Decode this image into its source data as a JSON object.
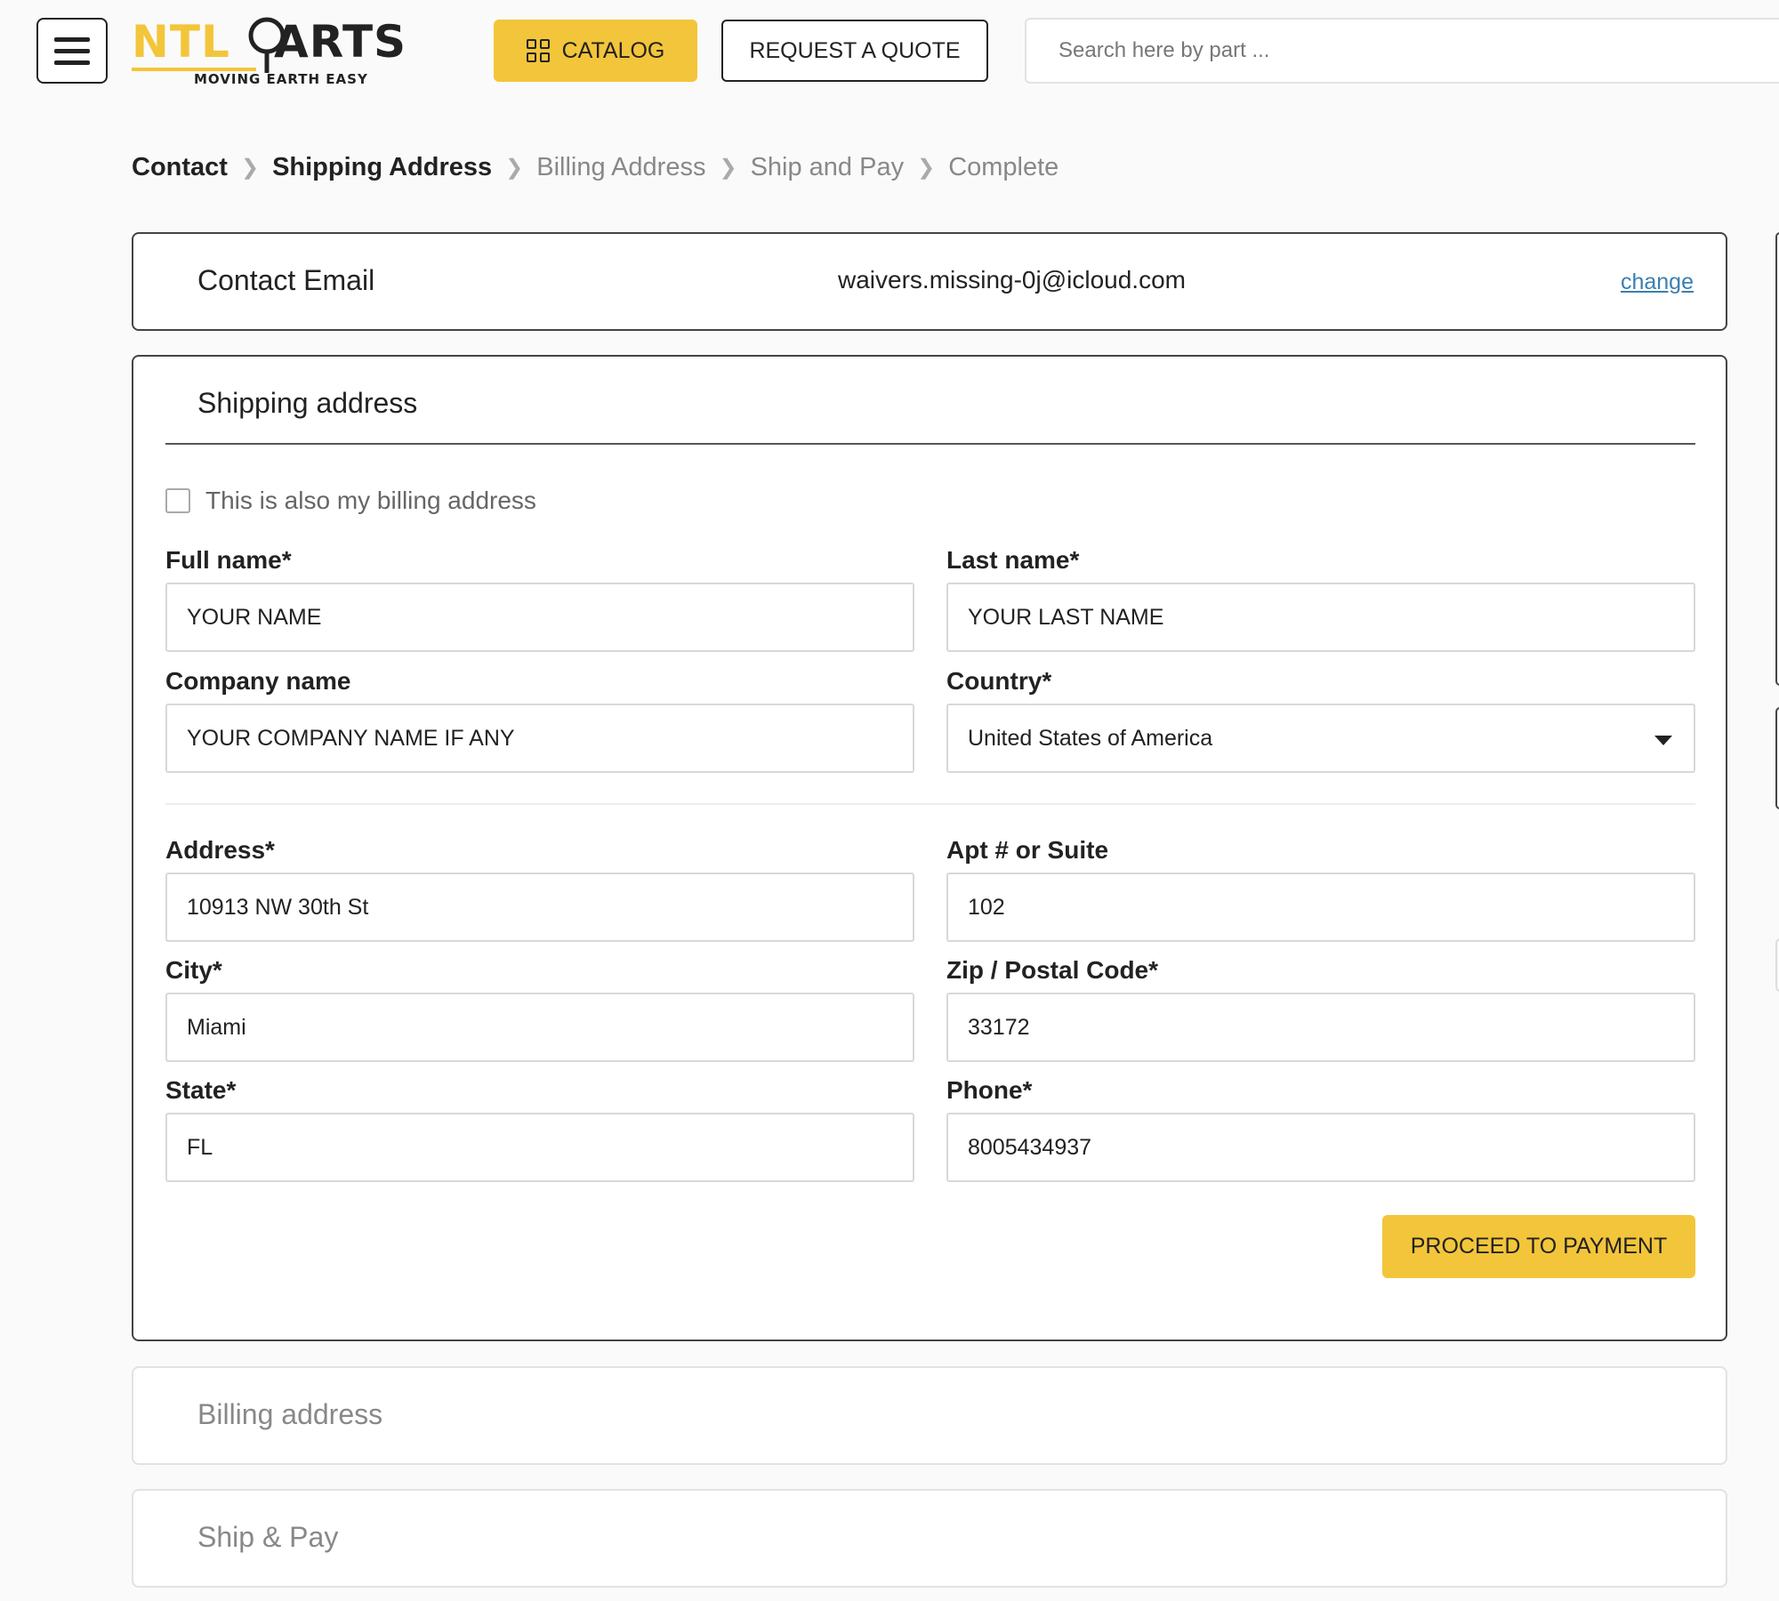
{
  "header": {
    "logo": {
      "brand_left": "NTL",
      "brand_right": "ARTS",
      "tagline": "MOVING EARTH EASY"
    },
    "catalog_label": "CATALOG",
    "quote_label": "REQUEST A QUOTE",
    "search_placeholder": "Search here by part ..."
  },
  "breadcrumb": [
    {
      "label": "Contact"
    },
    {
      "label": "Shipping Address"
    },
    {
      "label": "Billing Address"
    },
    {
      "label": "Ship and Pay"
    },
    {
      "label": "Complete"
    }
  ],
  "contact": {
    "label": "Contact Email",
    "email": "waivers.missing-0j@icloud.com",
    "change_label": "change"
  },
  "shipping": {
    "title": "Shipping address",
    "billing_checkbox_label": "This is also my billing address",
    "fields": {
      "full_name": {
        "label": "Full name*",
        "value": "YOUR NAME"
      },
      "last_name": {
        "label": "Last name*",
        "value": "YOUR LAST NAME"
      },
      "company": {
        "label": "Company name",
        "value": "YOUR COMPANY NAME IF ANY"
      },
      "country": {
        "label": "Country*",
        "value": "United States of America"
      },
      "address": {
        "label": "Address*",
        "value": "10913 NW 30th St"
      },
      "apt": {
        "label": "Apt # or Suite",
        "value": "102"
      },
      "city": {
        "label": "City*",
        "value": "Miami"
      },
      "zip": {
        "label": "Zip / Postal Code*",
        "value": "33172"
      },
      "state": {
        "label": "State*",
        "value": "FL"
      },
      "phone": {
        "label": "Phone*",
        "value": "8005434937"
      }
    },
    "proceed_label": "PROCEED TO PAYMENT"
  },
  "billing": {
    "title": "Billing address"
  },
  "ship_pay": {
    "title": "Ship & Pay"
  },
  "colors": {
    "accent": "#f3c53a",
    "link": "#3a7fb0",
    "text": "#222222"
  }
}
